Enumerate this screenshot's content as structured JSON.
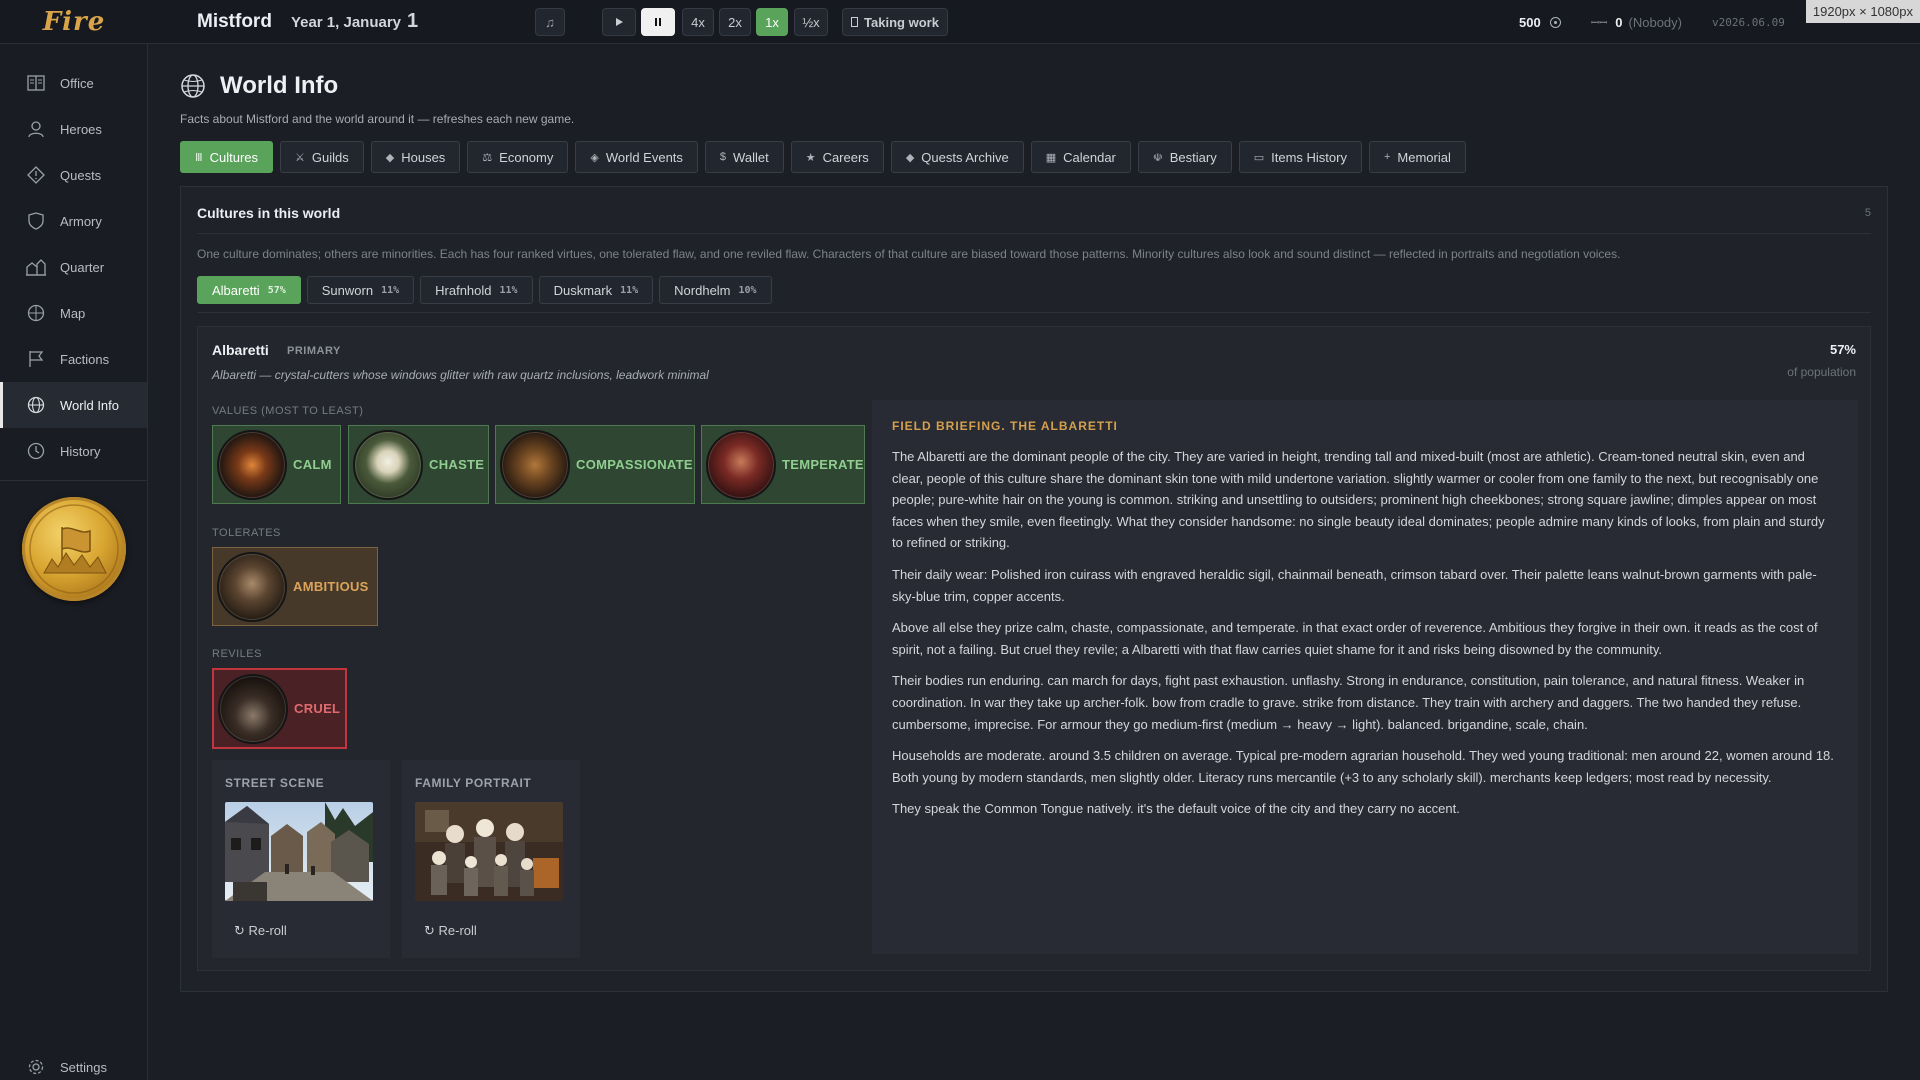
{
  "topbar": {
    "logo": "Fire",
    "city": "Mistford",
    "date_prefix": "Year 1, January",
    "date_day": "1",
    "speeds": [
      "4x",
      "2x",
      "1x",
      "½x"
    ],
    "status": "Taking work",
    "gold": "500",
    "followers": "0",
    "followers_note": "(Nobody)",
    "version": "v2026.06.09",
    "dims": "1920px × 1080px"
  },
  "sidebar": {
    "items": [
      {
        "label": "Office",
        "icon": "office-icon"
      },
      {
        "label": "Heroes",
        "icon": "person-icon"
      },
      {
        "label": "Quests",
        "icon": "diamond-icon"
      },
      {
        "label": "Armory",
        "icon": "shield-icon"
      },
      {
        "label": "Quarter",
        "icon": "buildings-icon"
      },
      {
        "label": "Map",
        "icon": "compass-icon"
      },
      {
        "label": "Factions",
        "icon": "flag-icon"
      },
      {
        "label": "World Info",
        "icon": "globe-icon"
      },
      {
        "label": "History",
        "icon": "clock-icon"
      }
    ],
    "active": "World Info",
    "settings": "Settings"
  },
  "page": {
    "title": "World Info",
    "subtitle": "Facts about Mistford and the world around it — refreshes each new game.",
    "tabs": [
      {
        "label": "Cultures",
        "icon": "Ⅲ"
      },
      {
        "label": "Guilds",
        "icon": "⚔"
      },
      {
        "label": "Houses",
        "icon": "◆"
      },
      {
        "label": "Economy",
        "icon": "⚖"
      },
      {
        "label": "World Events",
        "icon": "◈"
      },
      {
        "label": "Wallet",
        "icon": "$"
      },
      {
        "label": "Careers",
        "icon": "★"
      },
      {
        "label": "Quests Archive",
        "icon": "◆"
      },
      {
        "label": "Calendar",
        "icon": "▦"
      },
      {
        "label": "Bestiary",
        "icon": "☫"
      },
      {
        "label": "Items History",
        "icon": "▭"
      },
      {
        "label": "Memorial",
        "icon": "+"
      }
    ],
    "active_tab": "Cultures"
  },
  "cultures": {
    "heading": "Cultures in this world",
    "count": "5",
    "description": "One culture dominates; others are minorities. Each has four ranked virtues, one tolerated flaw, and one reviled flaw. Characters of that culture are biased toward those patterns. Minority cultures also look and sound distinct — reflected in portraits and negotiation voices.",
    "list": [
      {
        "name": "Albaretti",
        "pct": "57%"
      },
      {
        "name": "Sunworn",
        "pct": "11%"
      },
      {
        "name": "Hrafnhold",
        "pct": "11%"
      },
      {
        "name": "Duskmark",
        "pct": "11%"
      },
      {
        "name": "Nordhelm",
        "pct": "10%"
      }
    ],
    "selected": {
      "name": "Albaretti",
      "tag": "PRIMARY",
      "tagline": "Albaretti — crystal-cutters whose windows glitter with raw quartz inclusions, leadwork minimal",
      "population_pct": "57%",
      "population_label": "of population",
      "values_label": "VALUES (MOST TO LEAST)",
      "values": [
        "CALM",
        "CHASTE",
        "COMPASSIONATE",
        "TEMPERATE"
      ],
      "tolerates_label": "TOLERATES",
      "tolerates": "AMBITIOUS",
      "reviles_label": "REVILES",
      "reviles": "CRUEL",
      "street_scene": "STREET SCENE",
      "family_portrait": "FAMILY PORTRAIT",
      "reroll": "↻ Re-roll",
      "briefing_title": "FIELD BRIEFING. THE ALBARETTI",
      "briefing": [
        "The Albaretti are the dominant people of the city. They are varied in height, trending tall and mixed-built (most are athletic). Cream-toned neutral skin, even and clear, people of this culture share the dominant skin tone with mild undertone variation. slightly warmer or cooler from one family to the next, but recognisably one people; pure-white hair on the young is common. striking and unsettling to outsiders; prominent high cheekbones; strong square jawline; dimples appear on most faces when they smile, even fleetingly. What they consider handsome: no single beauty ideal dominates; people admire many kinds of looks, from plain and sturdy to refined or striking.",
        "Their daily wear: Polished iron cuirass with engraved heraldic sigil, chainmail beneath, crimson tabard over. Their palette leans walnut-brown garments with pale-sky-blue trim, copper accents.",
        "Above all else they prize calm, chaste, compassionate, and temperate. in that exact order of reverence. Ambitious they forgive in their own. it reads as the cost of spirit, not a failing. But cruel they revile; a Albaretti with that flaw carries quiet shame for it and risks being disowned by the community.",
        "Their bodies run enduring. can march for days, fight past exhaustion. unflashy. Strong in endurance, constitution, pain tolerance, and natural fitness. Weaker in coordination. In war they take up archer-folk. bow from cradle to grave. strike from distance. They train with archery and daggers. The two handed they refuse. cumbersome, imprecise. For armour they go medium-first (medium → heavy → light). balanced. brigandine, scale, chain.",
        "Households are moderate. around 3.5 children on average. Typical pre-modern agrarian household. They wed young traditional: men around 22, women around 18. Both young by modern standards, men slightly older. Literacy runs mercantile (+3 to any scholarly skill). merchants keep ledgers; most read by necessity.",
        "They speak the Common Tongue natively. it's the default voice of the city and they carry no accent."
      ]
    }
  },
  "colors": {
    "accent_green": "#5aa35a",
    "value_bg": "#2f4732",
    "tolerate_bg": "#46392a",
    "revile_border": "#c0363e",
    "briefing_gold": "#d4a04e"
  }
}
